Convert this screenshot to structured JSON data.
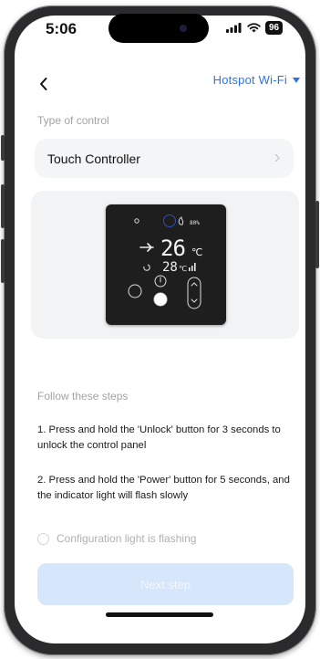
{
  "status_bar": {
    "time": "5:06",
    "battery": "96"
  },
  "nav": {
    "back_icon": "chevron-left-icon",
    "network": "Hotspot Wi-Fi"
  },
  "control": {
    "section_label": "Type of control",
    "selected": "Touch Controller"
  },
  "device_display": {
    "battery": "80%",
    "main_temp": "26",
    "main_unit": "℃",
    "set_temp": "28",
    "set_unit": "℃"
  },
  "steps": {
    "section_label": "Follow these steps",
    "step1": "1. Press and hold the 'Unlock' button for 3 seconds to unlock the control panel",
    "step2": "2. Press and hold the 'Power' button for 5 seconds, and the indicator light will flash slowly"
  },
  "confirm": {
    "label": "Configuration light is flashing",
    "checked": false
  },
  "next_button": {
    "label": "Next step",
    "enabled": false
  },
  "colors": {
    "accent": "#2f74e6",
    "button_disabled": "#d6e6fb",
    "muted_text": "#a3a3a3"
  }
}
